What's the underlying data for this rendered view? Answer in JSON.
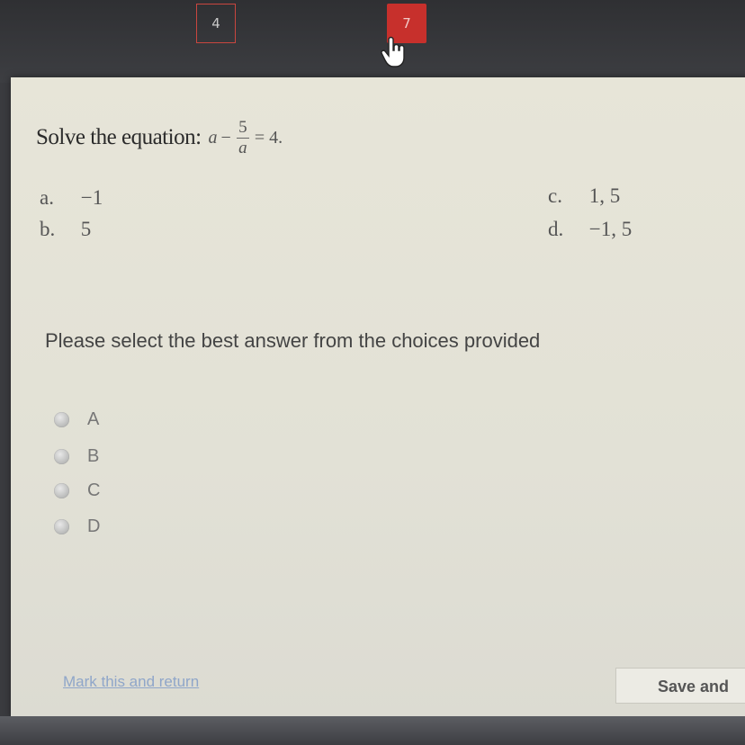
{
  "nav": {
    "question_numbers": [
      "4",
      "7"
    ],
    "active_index": 1
  },
  "question": {
    "prompt": "Solve the equation:",
    "equation": {
      "lhs_var": "a",
      "minus": "−",
      "frac_num": "5",
      "frac_den": "a",
      "equals": "= 4",
      "period": "."
    }
  },
  "choices": [
    {
      "letter": "a.",
      "value": "−1"
    },
    {
      "letter": "b.",
      "value": "5"
    },
    {
      "letter": "c.",
      "value": "1, 5"
    },
    {
      "letter": "d.",
      "value": "−1, 5"
    }
  ],
  "instruction": "Please select the best answer from the choices provided",
  "options": [
    "A",
    "B",
    "C",
    "D"
  ],
  "footer": {
    "mark_link": "Mark this and return",
    "save_label": "Save and"
  },
  "colors": {
    "active_nav": "#c7302c",
    "nav_border": "#c9463f",
    "link": "#8fa6c9",
    "panel": "#e5e3d8"
  }
}
